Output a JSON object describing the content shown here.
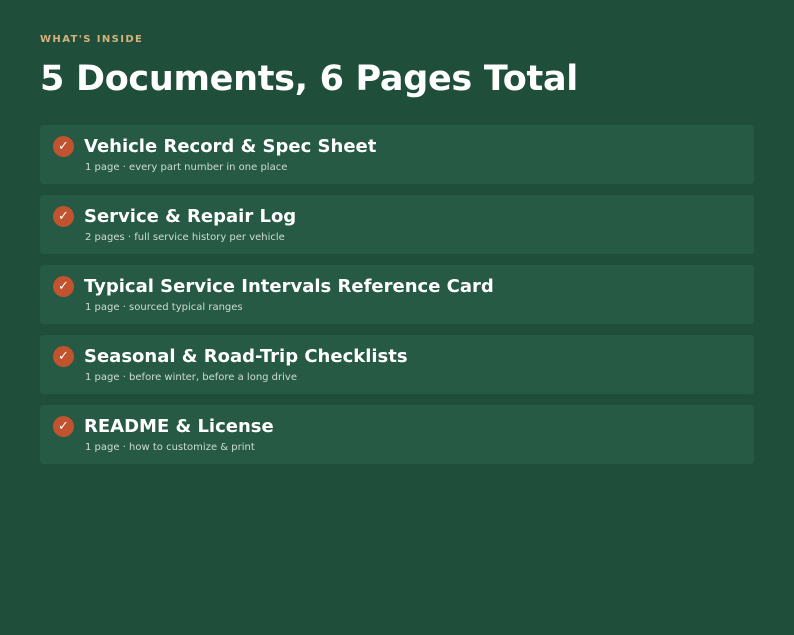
{
  "header": {
    "eyebrow": "WHAT'S INSIDE",
    "title": "5 Documents, 6 Pages Total"
  },
  "items": [
    {
      "icon": "check-icon",
      "check": "✓",
      "title": "Vehicle Record & Spec Sheet",
      "subtitle": "1 page · every part number in one place"
    },
    {
      "icon": "check-icon",
      "check": "✓",
      "title": "Service & Repair Log",
      "subtitle": "2 pages · full service history per vehicle"
    },
    {
      "icon": "check-icon",
      "check": "✓",
      "title": "Typical Service Intervals Reference Card",
      "subtitle": "1 page · sourced typical ranges"
    },
    {
      "icon": "check-icon",
      "check": "✓",
      "title": "Seasonal & Road-Trip Checklists",
      "subtitle": "1 page · before winter, before a long drive"
    },
    {
      "icon": "check-icon",
      "check": "✓",
      "title": "README & License",
      "subtitle": "1 page · how to customize & print"
    }
  ],
  "colors": {
    "background": "#1f4f3b",
    "card": "#265a45",
    "accent": "#c2532f",
    "eyebrow": "#d6b27a"
  }
}
